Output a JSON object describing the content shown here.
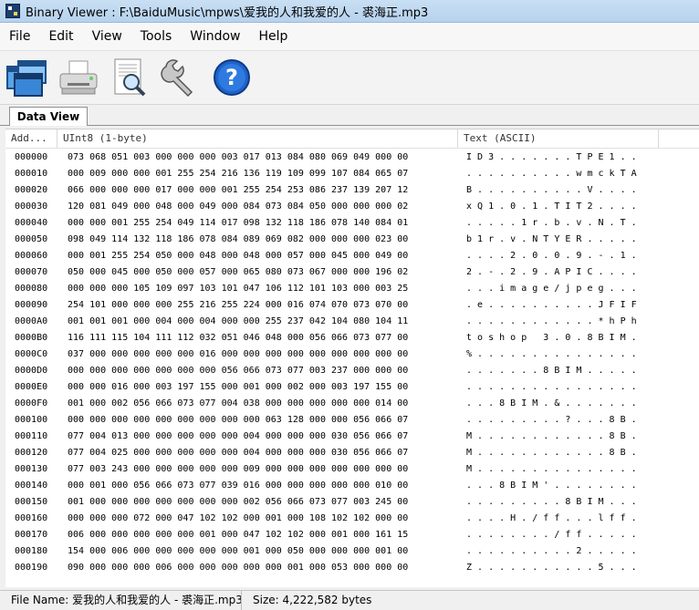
{
  "window": {
    "title": "Binary Viewer : F:\\BaiduMusic\\mpws\\爱我的人和我爱的人 - 裘海正.mp3"
  },
  "menu": [
    "File",
    "Edit",
    "View",
    "Tools",
    "Window",
    "Help"
  ],
  "toolbar": {
    "icons": [
      "open-windows-icon",
      "print-icon",
      "preview-icon",
      "tools-wrench-icon",
      "help-icon"
    ]
  },
  "tabs": [
    {
      "label": "Data View"
    }
  ],
  "grid": {
    "columns": [
      "Add...",
      "UInt8 (1-byte)",
      "Text (ASCII)"
    ],
    "rows": [
      {
        "addr": "000000",
        "bytes": "073 068 051 003 000 000 000 003 017 013 084 080 069 049 000 00",
        "text": "I D 3 . . . . . . . T P E 1 . ."
      },
      {
        "addr": "000010",
        "bytes": "000 009 000 000 001 255 254 216 136 119 109 099 107 084 065 07",
        "text": ". . . . . . . . . . w m c k T A"
      },
      {
        "addr": "000020",
        "bytes": "066 000 000 000 017 000 000 001 255 254 253 086 237 139 207 12",
        "text": "B . . . . . . . . . . V . . . ."
      },
      {
        "addr": "000030",
        "bytes": "120 081 049 000 048 000 049 000 084 073 084 050 000 000 000 02",
        "text": "x Q 1 . 0 . 1 . T I T 2 . . . ."
      },
      {
        "addr": "000040",
        "bytes": "000 000 001 255 254 049 114 017 098 132 118 186 078 140 084 01",
        "text": ". . . . . 1 r . b . v . N . T ."
      },
      {
        "addr": "000050",
        "bytes": "098 049 114 132 118 186 078 084 089 069 082 000 000 000 023 00",
        "text": "b 1 r . v . N T Y E R . . . . ."
      },
      {
        "addr": "000060",
        "bytes": "000 001 255 254 050 000 048 000 048 000 057 000 045 000 049 00",
        "text": ". . . . 2 . 0 . 0 . 9 . - . 1 ."
      },
      {
        "addr": "000070",
        "bytes": "050 000 045 000 050 000 057 000 065 080 073 067 000 000 196 02",
        "text": "2 . - . 2 . 9 . A P I C . . . ."
      },
      {
        "addr": "000080",
        "bytes": "000 000 000 105 109 097 103 101 047 106 112 101 103 000 003 25",
        "text": ". . . i m a g e / j p e g . . ."
      },
      {
        "addr": "000090",
        "bytes": "254 101 000 000 000 255 216 255 224 000 016 074 070 073 070 00",
        "text": ". e . . . . . . . . . . J F I F"
      },
      {
        "addr": "0000A0",
        "bytes": "001 001 001 000 004 000 004 000 000 255 237 042 104 080 104 11",
        "text": ". . . . . . . . . . . . * h P h"
      },
      {
        "addr": "0000B0",
        "bytes": "116 111 115 104 111 112 032 051 046 048 000 056 066 073 077 00",
        "text": "t o s h o p   3 . 0 . 8 B I M ."
      },
      {
        "addr": "0000C0",
        "bytes": "037 000 000 000 000 000 016 000 000 000 000 000 000 000 000 00",
        "text": "% . . . . . . . . . . . . . . ."
      },
      {
        "addr": "0000D0",
        "bytes": "000 000 000 000 000 000 000 056 066 073 077 003 237 000 000 00",
        "text": ". . . . . . . 8 B I M . . . . ."
      },
      {
        "addr": "0000E0",
        "bytes": "000 000 016 000 003 197 155 000 001 000 002 000 003 197 155 00",
        "text": ". . . . . . . . . . . . . . . ."
      },
      {
        "addr": "0000F0",
        "bytes": "001 000 002 056 066 073 077 004 038 000 000 000 000 000 014 00",
        "text": ". . . 8 B I M . & . . . . . . ."
      },
      {
        "addr": "000100",
        "bytes": "000 000 000 000 000 000 000 000 000 063 128 000 000 056 066 07",
        "text": ". . . . . . . . . ? . . . 8 B ."
      },
      {
        "addr": "000110",
        "bytes": "077 004 013 000 000 000 000 000 004 000 000 000 030 056 066 07",
        "text": "M . . . . . . . . . . . . 8 B ."
      },
      {
        "addr": "000120",
        "bytes": "077 004 025 000 000 000 000 000 004 000 000 000 030 056 066 07",
        "text": "M . . . . . . . . . . . . 8 B ."
      },
      {
        "addr": "000130",
        "bytes": "077 003 243 000 000 000 000 000 009 000 000 000 000 000 000 00",
        "text": "M . . . . . . . . . . . . . . ."
      },
      {
        "addr": "000140",
        "bytes": "000 001 000 056 066 073 077 039 016 000 000 000 000 000 010 00",
        "text": ". . . 8 B I M ' . . . . . . . ."
      },
      {
        "addr": "000150",
        "bytes": "001 000 000 000 000 000 000 000 002 056 066 073 077 003 245 00",
        "text": ". . . . . . . . . 8 B I M . . ."
      },
      {
        "addr": "000160",
        "bytes": "000 000 000 072 000 047 102 102 000 001 000 108 102 102 000 00",
        "text": ". . . . H . / f f . . . l f f ."
      },
      {
        "addr": "000170",
        "bytes": "006 000 000 000 000 000 001 000 047 102 102 000 001 000 161 15",
        "text": ". . . . . . . . / f f . . . . ."
      },
      {
        "addr": "000180",
        "bytes": "154 000 006 000 000 000 000 000 001 000 050 000 000 000 001 00",
        "text": ". . . . . . . . . . 2 . . . . ."
      },
      {
        "addr": "000190",
        "bytes": "090 000 000 000 006 000 000 000 000 000 001 000 053 000 000 00",
        "text": "Z . . . . . . . . . . . 5 . . ."
      }
    ]
  },
  "status": {
    "file_name": "File Name: 爱我的人和我爱的人 - 裘海正.mp3",
    "size": "Size: 4,222,582 bytes"
  }
}
